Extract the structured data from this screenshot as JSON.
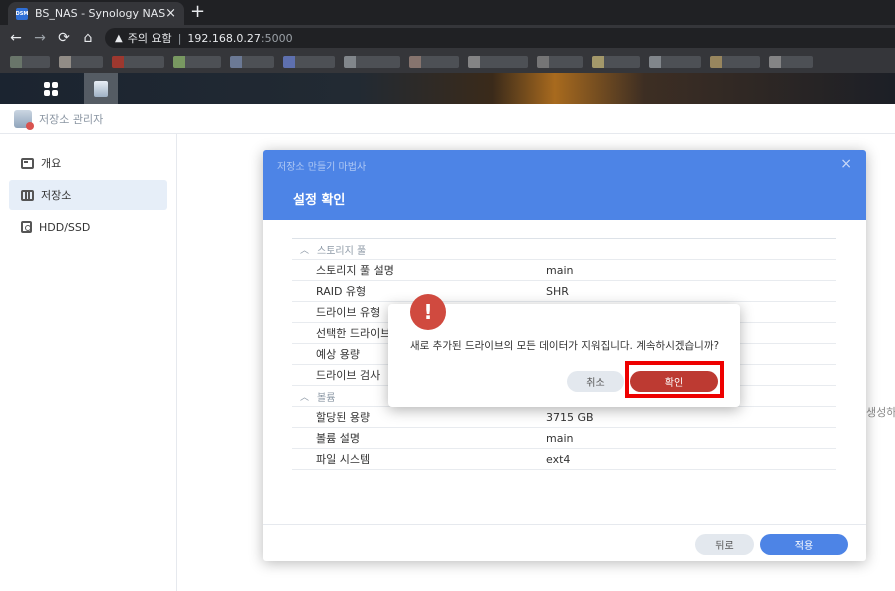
{
  "browser": {
    "tab_favicon": "DSM",
    "tab_title": "BS_NAS - Synology NAS",
    "tab_close": "×",
    "new_tab": "+",
    "back": "←",
    "forward": "→",
    "reload": "⟳",
    "home": "⌂",
    "warning_icon": "▲",
    "security_text": "주의 요함",
    "separator": "|",
    "url_host": "192.168.0.27",
    "url_port": ":5000",
    "bookmark_colors": [
      "#7a8a7a",
      "#b0a8a0",
      "#c0392b",
      "#8fb96e",
      "#7d8fb3",
      "#6c84d6",
      "#9aa0a6",
      "#a1887f",
      "#9e9e9e",
      "#8a8a8a",
      "#c8b87a",
      "#9aa0a6",
      "#b9a06a",
      "#9e9e9e"
    ]
  },
  "app": {
    "title": "저장소 관리자",
    "sidebar": [
      {
        "label": "개요",
        "icon": "overview-icon"
      },
      {
        "label": "저장소",
        "icon": "storage-icon"
      },
      {
        "label": "HDD/SSD",
        "icon": "hdd-icon"
      }
    ],
    "edge_text": "생성하"
  },
  "wizard": {
    "title": "저장소 만들기 마법사",
    "close": "×",
    "subtitle": "설정 확인",
    "sections": [
      {
        "name": "스토리지 풀",
        "rows": [
          {
            "key": "스토리지 풀 설명",
            "value": "main"
          },
          {
            "key": "RAID 유형",
            "value": "SHR"
          },
          {
            "key": "드라이브 유형",
            "value": ""
          },
          {
            "key": "선택한 드라이브",
            "value": ""
          },
          {
            "key": "예상 용량",
            "value": ""
          },
          {
            "key": "드라이브 검사",
            "value": ""
          }
        ]
      },
      {
        "name": "볼륨",
        "rows": [
          {
            "key": "할당된 용량",
            "value": "3715 GB"
          },
          {
            "key": "볼륨 설명",
            "value": "main"
          },
          {
            "key": "파일 시스템",
            "value": "ext4"
          }
        ]
      }
    ],
    "back_label": "뒤로",
    "apply_label": "적용"
  },
  "confirm": {
    "icon_glyph": "!",
    "message": "새로 추가된 드라이브의 모든 데이터가 지워집니다. 계속하시겠습니까?",
    "cancel_label": "취소",
    "ok_label": "확인"
  },
  "colors": {
    "accent": "#4d84e6",
    "danger": "#bd3a32",
    "highlight": "#ee0000"
  }
}
